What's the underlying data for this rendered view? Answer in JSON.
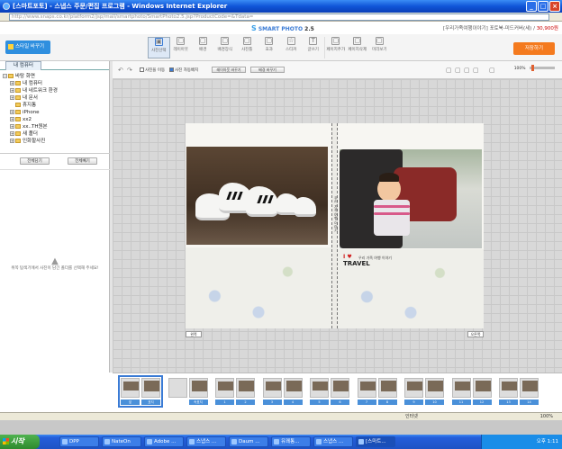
{
  "window": {
    "title": "[스마트포토] - 스냅스 주문/편집 프로그램 - Windows Internet Explorer",
    "url": "http://www.snaps.co.kr/platform2/jsp/mall/smartphoto/SmartPhoto2.5.jsp?ProductCode=&Tdata=",
    "min": "_",
    "max": "□",
    "close": "×"
  },
  "app": {
    "logo_s": "S",
    "logo_name": "SMART PHOTO",
    "logo_ver": "2.5",
    "project_title": "[우리가족여행이야기] 포토북-미드커버(세) /",
    "project_price": "30,900원",
    "style_button": "스타일 바꾸기",
    "order_button": "저장하기",
    "tools": [
      {
        "icon": "▣",
        "label": "사진선택"
      },
      {
        "icon": "▢",
        "label": "레이아웃"
      },
      {
        "icon": "▢",
        "label": "배경"
      },
      {
        "icon": "▢",
        "label": "배경장식"
      },
      {
        "icon": "▢",
        "label": "사진틀"
      },
      {
        "icon": "▢",
        "label": "효과"
      },
      {
        "icon": "☆",
        "label": "스티커"
      },
      {
        "icon": "T",
        "label": "글쓰기"
      },
      {
        "icon": "▢",
        "label": "페이지추가"
      },
      {
        "icon": "▢",
        "label": "페이지삭제"
      },
      {
        "icon": "▢",
        "label": "미리보기"
      }
    ]
  },
  "leftpanel": {
    "tab": "내 컴퓨터",
    "tree": [
      {
        "pm": "−",
        "label": "바탕 화면",
        "indent": 0
      },
      {
        "pm": "+",
        "label": "내 컴퓨터",
        "indent": 1
      },
      {
        "pm": "+",
        "label": "내 네트워크 환경",
        "indent": 1
      },
      {
        "pm": "+",
        "label": "내 문서",
        "indent": 1
      },
      {
        "pm": "",
        "label": "휴지통",
        "indent": 1
      },
      {
        "pm": "+",
        "label": "iPhone",
        "indent": 1
      },
      {
        "pm": "+",
        "label": "xx2",
        "indent": 1
      },
      {
        "pm": "+",
        "label": "xx..TH원본",
        "indent": 1
      },
      {
        "pm": "+",
        "label": "새 폴더",
        "indent": 1
      },
      {
        "pm": "+",
        "label": "인화할사진",
        "indent": 1
      }
    ],
    "btn_left": "전체담기",
    "btn_right": "전체빼기",
    "hint": "위쪽 탐색기에서 사진이 담긴 폴더를 선택해 주세요!"
  },
  "canvasbar": {
    "undo": "↶",
    "redo": "↷",
    "check1": "사진을 이동",
    "check2": "사진 자동배치",
    "btn1": "레이아웃 바꾸기",
    "btn2": "배경 바꾸기",
    "zoom": "100%"
  },
  "pages": {
    "left_label": "왼쪽",
    "right_label": "오른쪽",
    "spine_text": "우리 가족 여행 이야기",
    "travel": "TRAVEL",
    "travel_heart": "I ♥",
    "travel_sub": "우리 가족 여행 이야기"
  },
  "thumbs": [
    {
      "l": "앞",
      "r": "표지",
      "active": true
    },
    {
      "l": "",
      "r": "속표지"
    },
    {
      "l": "1",
      "r": "2"
    },
    {
      "l": "3",
      "r": "4"
    },
    {
      "l": "5",
      "r": "6"
    },
    {
      "l": "7",
      "r": "8"
    },
    {
      "l": "9",
      "r": "10"
    },
    {
      "l": "11",
      "r": "12"
    },
    {
      "l": "13",
      "r": "14"
    }
  ],
  "statusbar": {
    "zone": "인터넷",
    "zoom": "100%"
  },
  "taskbar": {
    "start": "시작",
    "tasks": [
      "DPP",
      "NateOn",
      "Adobe ...",
      "스냅스 ...",
      "Daum ...",
      "유쾌통...",
      "스냅스 ...",
      "[스마트..."
    ],
    "clock": "오후 1:11"
  }
}
